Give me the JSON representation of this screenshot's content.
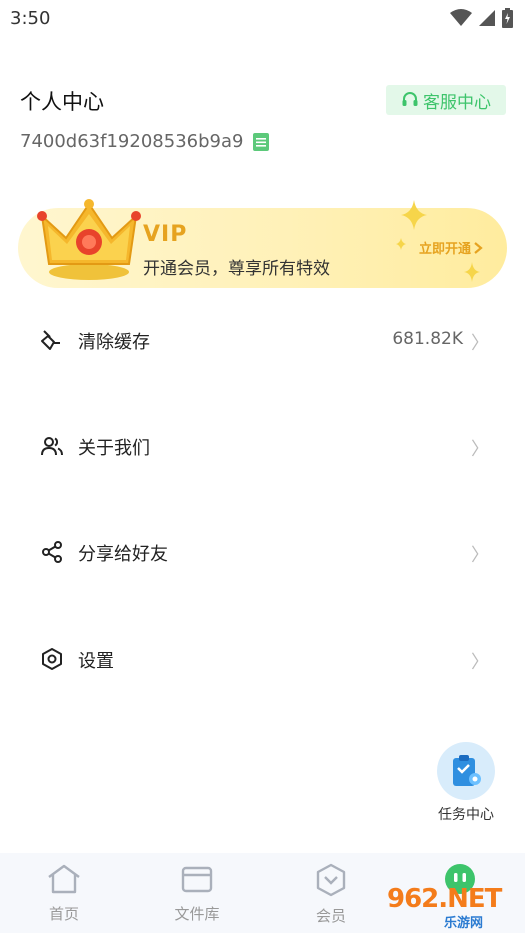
{
  "status_bar": {
    "time": "3:50"
  },
  "header": {
    "title": "个人中心",
    "service_label": "客服中心",
    "user_id": "7400d63f19208536b9a9"
  },
  "vip": {
    "title": "VIP",
    "subtitle": "开通会员，尊享所有特效",
    "open_label": "立即开通"
  },
  "menu": [
    {
      "label": "清除缓存",
      "value": "681.82K",
      "icon": "broom-icon"
    },
    {
      "label": "关于我们",
      "value": "",
      "icon": "users-icon"
    },
    {
      "label": "分享给好友",
      "value": "",
      "icon": "share-icon"
    },
    {
      "label": "设置",
      "value": "",
      "icon": "settings-icon"
    }
  ],
  "task_center": {
    "label": "任务中心"
  },
  "bottom_nav": [
    {
      "label": "首页",
      "icon": "home-icon"
    },
    {
      "label": "文件库",
      "icon": "folder-icon"
    },
    {
      "label": "会员",
      "icon": "vip-shield-icon"
    },
    {
      "label": "",
      "icon": "profile-icon"
    }
  ],
  "watermark": {
    "main": "962.NET",
    "sub": "乐游网"
  },
  "colors": {
    "accent_green": "#3dc46b",
    "vip_gold": "#e6a320",
    "task_blue": "#2f8fe0"
  }
}
